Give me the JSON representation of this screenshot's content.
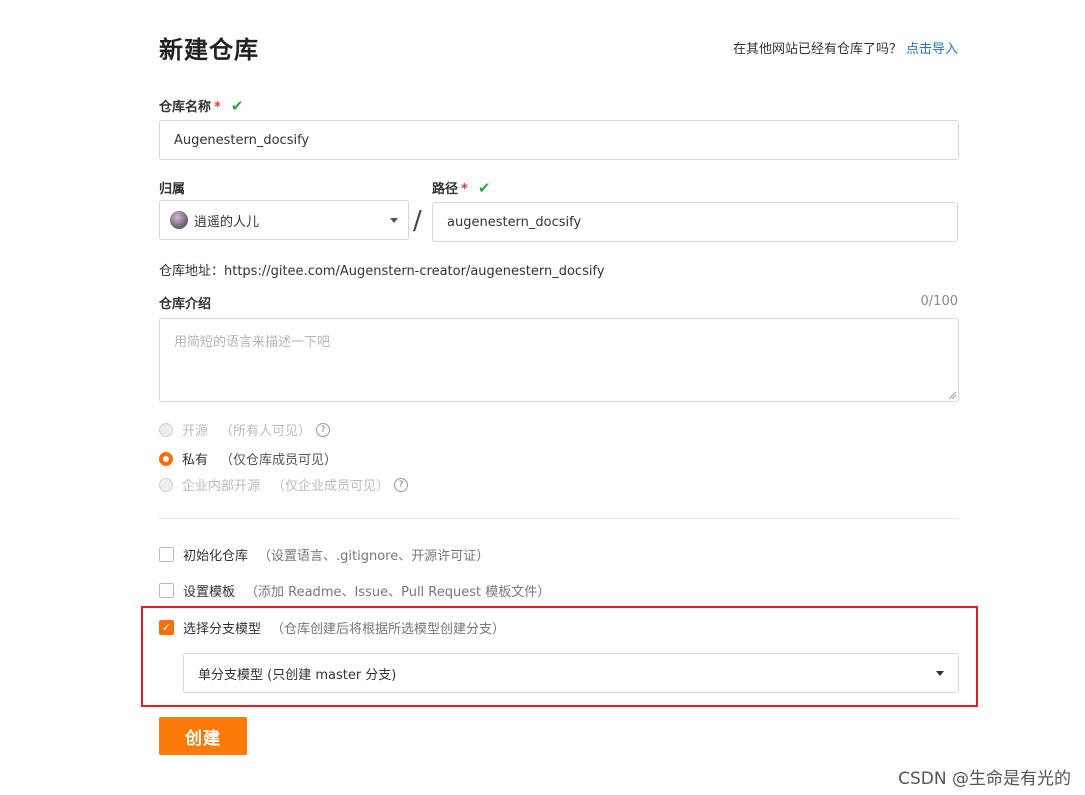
{
  "header": {
    "title": "新建仓库",
    "import_prompt": "在其他网站已经有仓库了吗？",
    "import_link": "点击导入"
  },
  "repo_name": {
    "label": "仓库名称",
    "required_mark": "*",
    "value": "Augenestern_docsify"
  },
  "owner": {
    "label": "归属",
    "value": "逍遥的人儿"
  },
  "separator": "/",
  "path": {
    "label": "路径",
    "required_mark": "*",
    "value": "augenestern_docsify"
  },
  "address": "仓库地址：https://gitee.com/Augenstern-creator/augenestern_docsify",
  "description": {
    "label": "仓库介绍",
    "counter": "0/100",
    "placeholder": "用简短的语言来描述一下吧"
  },
  "visibility": [
    {
      "label": "开源",
      "note": "（所有人可见）",
      "selected": false,
      "disabled": true,
      "help_icon": "question-circle-icon"
    },
    {
      "label": "私有",
      "note": "（仅仓库成员可见）",
      "selected": true,
      "disabled": false
    },
    {
      "label": "企业内部开源",
      "note": "（仅企业成员可见）",
      "selected": false,
      "disabled": true,
      "help_icon": "question-circle-icon"
    }
  ],
  "options": {
    "init": {
      "label": "初始化仓库",
      "note": "（设置语言、.gitignore、开源许可证）",
      "checked": false
    },
    "template": {
      "label": "设置模板",
      "note": "（添加 Readme、Issue、Pull Request 模板文件）",
      "checked": false
    },
    "branch_model": {
      "label": "选择分支模型",
      "note": "（仓库创建后将根据所选模型创建分支）",
      "checked": true
    }
  },
  "branch_select": {
    "value": "单分支模型 (只创建 master 分支)"
  },
  "submit_label": "创建",
  "watermark": "CSDN @生命是有光的",
  "colors": {
    "accent": "#fb7a09",
    "link": "#1e6fd9",
    "success": "#2ea44f",
    "required": "#e23c3c",
    "highlight_border": "#e02020"
  }
}
